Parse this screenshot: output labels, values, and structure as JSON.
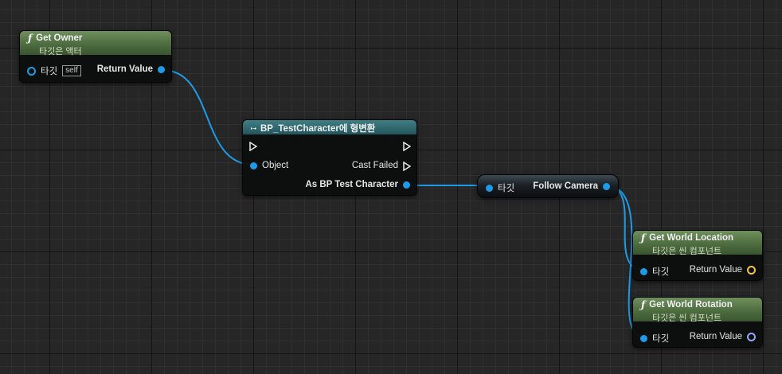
{
  "nodes": {
    "get_owner": {
      "title": "Get Owner",
      "subtitle": "타깃은 액터",
      "target_label": "타깃",
      "self_tag": "self",
      "return_label": "Return Value",
      "icon": "function-icon"
    },
    "cast": {
      "title": "BP_TestCharacter에 형변환",
      "object_label": "Object",
      "cast_failed_label": "Cast Failed",
      "as_label": "As BP Test Character",
      "icon": "cast-icon"
    },
    "follow_camera": {
      "target_label": "타깃",
      "output_label": "Follow Camera"
    },
    "get_world_location": {
      "title": "Get World Location",
      "subtitle": "타깃은 씬 컴포넌트",
      "target_label": "타깃",
      "return_label": "Return Value",
      "icon": "function-icon"
    },
    "get_world_rotation": {
      "title": "Get World Rotation",
      "subtitle": "타깃은 씬 컴포넌트",
      "target_label": "타깃",
      "return_label": "Return Value",
      "icon": "function-icon"
    }
  },
  "colors": {
    "object_pin": "#1e9be8",
    "vector_pin": "#f4c542",
    "rotator_pin": "#9aa5f0",
    "function_header": "#4b6a3d",
    "cast_header": "#24555b",
    "grid_bg": "#262626"
  }
}
